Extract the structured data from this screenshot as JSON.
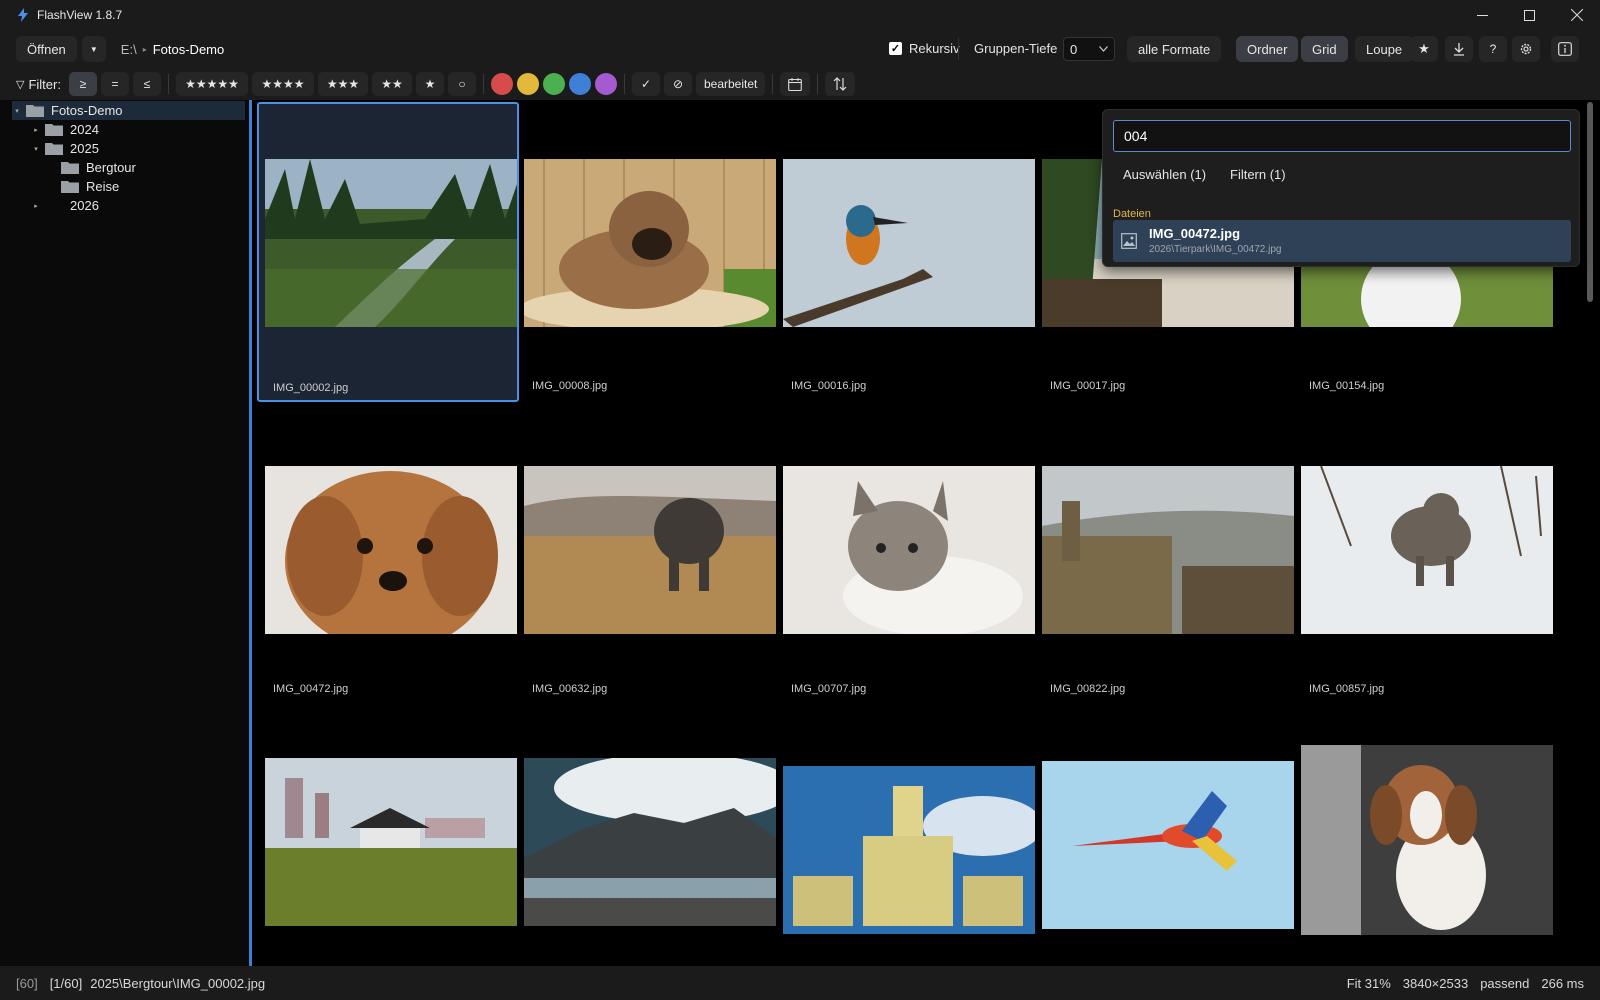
{
  "app": {
    "title": "FlashView 1.8.7"
  },
  "toolbar": {
    "open_label": "Öffnen",
    "open_dropdown_icon": "caret-down-icon",
    "breadcrumb": {
      "drive": "E:\\",
      "folder": "Fotos-Demo"
    },
    "recursive_label": "Rekursiv",
    "recursive_checked": true,
    "group_depth_label": "Gruppen-Tiefe",
    "group_depth_value": "0",
    "formats_label": "alle Formate",
    "views": {
      "folder": "Ordner",
      "grid": "Grid",
      "loupe": "Loupe"
    },
    "active_view": "Grid"
  },
  "filterbar": {
    "label": "Filter:",
    "compare": {
      "ge": "≥",
      "eq": "=",
      "le": "≤"
    },
    "stars": {
      "five": "★★★★★",
      "four": "★★★★",
      "three": "★★★",
      "two": "★★",
      "one": "★",
      "none": "○"
    },
    "colors": [
      "#d74b4b",
      "#e2b93b",
      "#4caf50",
      "#3f7fd8",
      "#a45bd1"
    ],
    "accepted": "✓",
    "rejected": "⊘",
    "edited_label": "bearbeitet"
  },
  "sidebar": {
    "root": "Fotos-Demo",
    "items": [
      {
        "label": "2024"
      },
      {
        "label": "2025"
      },
      {
        "label": "Bergtour"
      },
      {
        "label": "Reise"
      },
      {
        "label": "2026"
      }
    ]
  },
  "grid": {
    "items": [
      {
        "name": "IMG_00002.jpg"
      },
      {
        "name": "IMG_00008.jpg"
      },
      {
        "name": "IMG_00016.jpg"
      },
      {
        "name": "IMG_00017.jpg"
      },
      {
        "name": "IMG_00154.jpg"
      },
      {
        "name": "IMG_00472.jpg"
      },
      {
        "name": "IMG_00632.jpg"
      },
      {
        "name": "IMG_00707.jpg"
      },
      {
        "name": "IMG_00822.jpg"
      },
      {
        "name": "IMG_00857.jpg"
      }
    ]
  },
  "search": {
    "query": "004",
    "select_label": "Auswählen (1)",
    "filter_label": "Filtern (1)",
    "section_title": "Dateien",
    "result": {
      "name": "IMG_00472.jpg",
      "path": "2026\\Tierpark\\IMG_00472.jpg"
    }
  },
  "status": {
    "count": "[60]",
    "position": "[1/60]",
    "path": "2025\\Bergtour\\IMG_00002.jpg",
    "zoom": "Fit 31%",
    "dimensions": "3840×2533",
    "fit_mode": "passend",
    "load_time": "266 ms"
  }
}
